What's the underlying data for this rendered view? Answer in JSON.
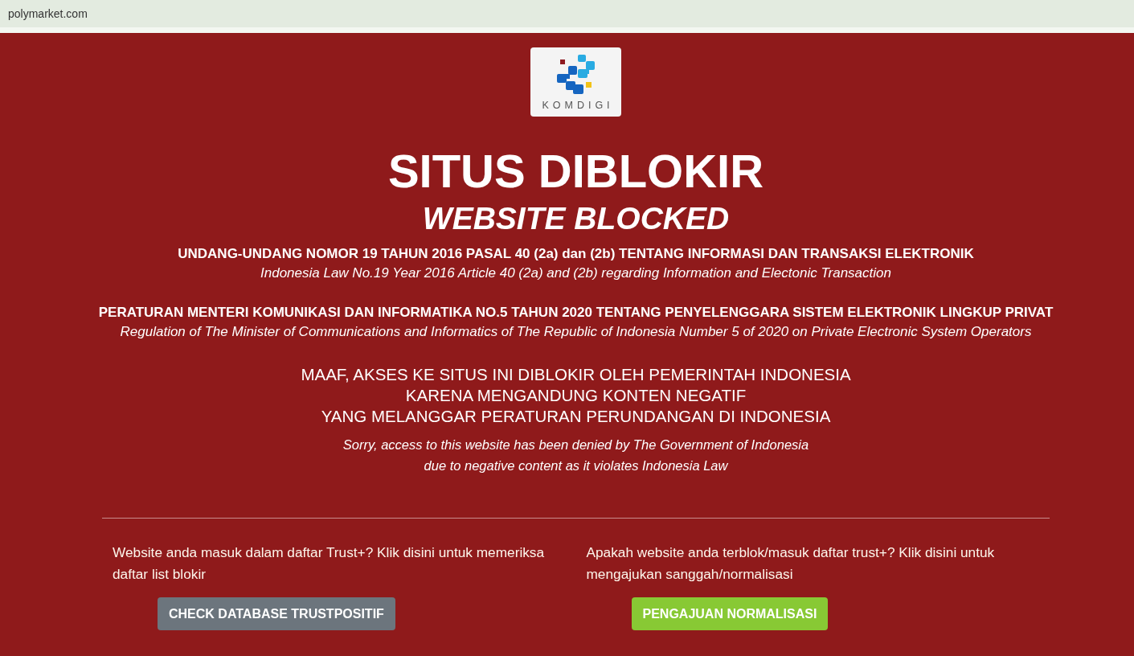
{
  "browser": {
    "address": "polymarket.com"
  },
  "logo": {
    "text": "KOMDIGI"
  },
  "heading": {
    "title": "SITUS DIBLOKIR",
    "subtitle": "WEBSITE BLOCKED"
  },
  "legal_notes": [
    {
      "title": "UNDANG-UNDANG NOMOR 19 TAHUN 2016 PASAL 40 (2a) dan (2b) TENTANG INFORMASI DAN TRANSAKSI ELEKTRONIK",
      "translation": "Indonesia Law No.19 Year 2016 Article 40 (2a) and (2b) regarding Information and Electonic Transaction"
    },
    {
      "title": "PERATURAN MENTERI KOMUNIKASI DAN INFORMATIKA NO.5 TAHUN 2020 TENTANG PENYELENGGARA SISTEM ELEKTRONIK LINGKUP PRIVAT",
      "translation": "Regulation of The Minister of Communications and Informatics of The Republic of Indonesia Number 5 of 2020 on Private Electronic System Operators"
    }
  ],
  "message": {
    "text": "MAAF, AKSES KE SITUS INI DIBLOKIR OLEH PEMERINTAH INDONESIA\nKARENA MENGANDUNG KONTEN NEGATIF\nYANG MELANGGAR PERATURAN PERUNDANGAN DI INDONESIA",
    "translation": "Sorry, access to this website has been denied by The Government of Indonesia\ndue to negative content as it violates Indonesia Law"
  },
  "actions": [
    {
      "kind": "secondary",
      "text": "Website anda masuk dalam daftar Trust+? Klik disini untuk memeriksa daftar list blokir",
      "button": "CHECK DATABASE TRUSTPOSITIF"
    },
    {
      "kind": "success",
      "text": "Apakah website anda terblok/masuk daftar trust+? Klik disini untuk mengajukan sanggah/normalisasi",
      "button": "PENGAJUAN NORMALISASI"
    }
  ]
}
